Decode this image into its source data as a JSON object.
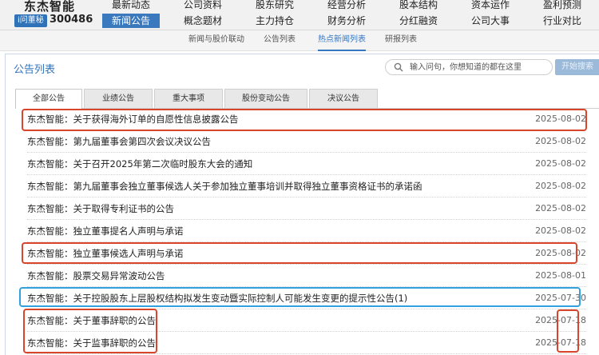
{
  "header": {
    "company_name": "东杰智能",
    "ask_badge": "i问董秘",
    "stock_code": "300486",
    "nav_row1": [
      "最新动态",
      "公司资料",
      "股东研究",
      "经营分析",
      "股本结构",
      "资本运作",
      "盈利预测"
    ],
    "nav_row2": [
      "新闻公告",
      "概念题材",
      "主力持仓",
      "财务分析",
      "分红融资",
      "公司大事",
      "行业对比"
    ]
  },
  "subnav": [
    "新闻与股价联动",
    "公告列表",
    "热点新闻列表",
    "研报列表"
  ],
  "panel": {
    "title": "公告列表",
    "search_placeholder": "输入问句，你想知道的都在这里",
    "search_button": "开始搜索"
  },
  "tabs": [
    "全部公告",
    "业绩公告",
    "重大事项",
    "股份变动公告",
    "决议公告"
  ],
  "announcements": [
    {
      "title": "东杰智能：关于获得海外订单的自愿性信息披露公告",
      "date": "2025-08-02"
    },
    {
      "title": "东杰智能：第九届董事会第四次会议决议公告",
      "date": "2025-08-02"
    },
    {
      "title": "东杰智能：关于召开2025年第二次临时股东大会的通知",
      "date": "2025-08-02"
    },
    {
      "title": "东杰智能：第九届董事会独立董事候选人关于参加独立董事培训并取得独立董事资格证书的承诺函",
      "date": "2025-08-02"
    },
    {
      "title": "东杰智能：关于取得专利证书的公告",
      "date": "2025-08-02"
    },
    {
      "title": "东杰智能：独立董事提名人声明与承诺",
      "date": "2025-08-02"
    },
    {
      "title": "东杰智能：独立董事候选人声明与承诺",
      "date": "2025-08-02"
    },
    {
      "title": "东杰智能：股票交易异常波动公告",
      "date": "2025-08-01"
    },
    {
      "title": "东杰智能：关于控股股东上层股权结构拟发生变动暨实际控制人可能发生变更的提示性公告(1)",
      "date": "2025-07-30"
    },
    {
      "title": "东杰智能：关于董事辞职的公告",
      "date": "2025-07-18"
    },
    {
      "title": "东杰智能：关于监事辞职的公告",
      "date": "2025-07-18"
    }
  ],
  "colors": {
    "accent": "#3b79bf",
    "highlight_red": "#d9452b",
    "highlight_blue": "#33a1e0"
  }
}
